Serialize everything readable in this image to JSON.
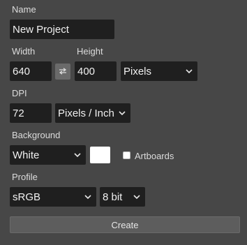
{
  "name": {
    "label": "Name",
    "value": "New Project"
  },
  "size": {
    "width_label": "Width",
    "width_value": "640",
    "height_label": "Height",
    "height_value": "400",
    "unit": "Pixels"
  },
  "dpi": {
    "label": "DPI",
    "value": "72",
    "unit": "Pixels / Inch"
  },
  "background": {
    "label": "Background",
    "value": "White",
    "color": "#ffffff",
    "artboards_label": "Artboards",
    "artboards_checked": false
  },
  "profile": {
    "label": "Profile",
    "value": "sRGB",
    "depth": "8 bit"
  },
  "create_label": "Create",
  "icons": {
    "swap": "swap-icon",
    "dropdown": "chevron-down-icon"
  }
}
